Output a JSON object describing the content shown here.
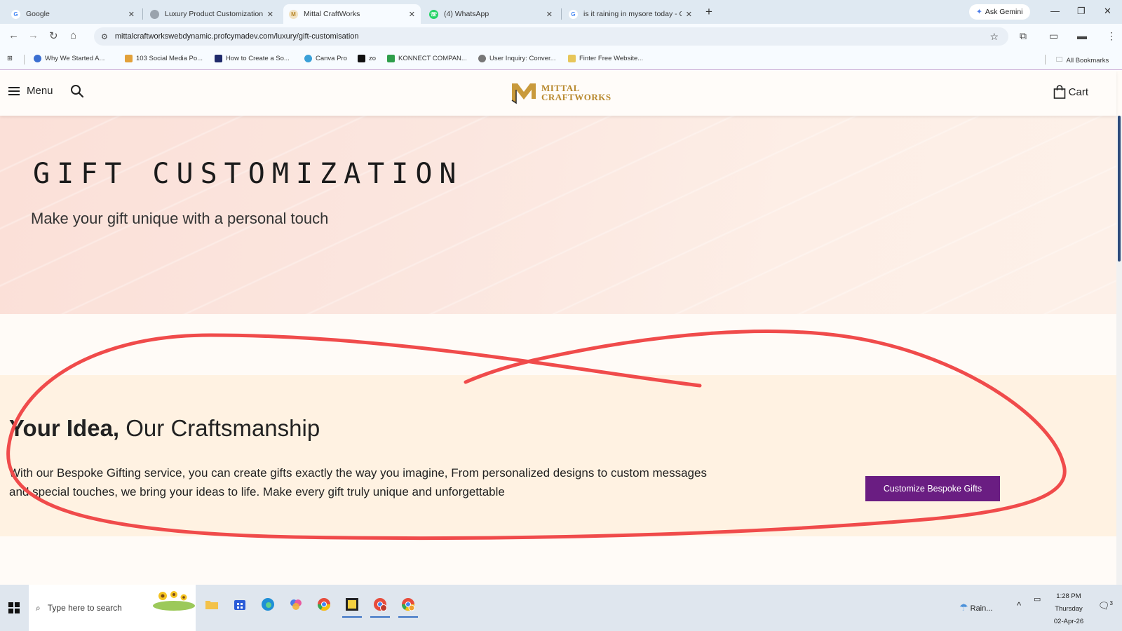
{
  "browser": {
    "tabs": [
      {
        "title": "Google",
        "favicon": "google-icon",
        "active": false
      },
      {
        "title": "Luxury Product Customization",
        "favicon": "globe-icon",
        "active": false
      },
      {
        "title": "Mittal CraftWorks",
        "favicon": "mittal-icon",
        "active": true
      },
      {
        "title": "(4) WhatsApp",
        "favicon": "whatsapp-icon",
        "active": false
      },
      {
        "title": "is it raining in mysore today - G",
        "favicon": "google-icon",
        "active": false
      }
    ],
    "ask_gemini": "Ask Gemini",
    "url": "mittalcraftworkswebdynamic.profcymadev.com/luxury/gift-customisation",
    "bookmarks": [
      "Why We Started A...",
      "103 Social Media Po...",
      "How to Create a So...",
      "Canva Pro",
      "zo",
      "KONNECT COMPAN...",
      "User Inquiry: Conver...",
      "Finter Free Website..."
    ],
    "all_bookmarks": "All Bookmarks"
  },
  "header": {
    "menu_label": "Menu",
    "logo_line1": "MITTAL",
    "logo_line2": "CRAFTWORKS",
    "cart_label": "Cart"
  },
  "hero": {
    "title": "GIFT CUSTOMIZATION",
    "subtitle": "Make your gift unique with a personal touch"
  },
  "idea_section": {
    "heading_bold": "Your Idea,",
    "heading_rest": " Our Craftsmanship",
    "description": "With our Bespoke Gifting service, you can create gifts exactly the way you imagine, From personalized designs to custom messages and special touches, we bring your ideas to life. Make every gift truly unique and unforgettable",
    "button_label": "Customize Bespoke Gifts"
  },
  "taskbar": {
    "search_placeholder": "Type here to search",
    "weather": "Rain...",
    "time": "1:28 PM",
    "day": "Thursday",
    "date": "02-Apr-26",
    "notification_count": "3"
  },
  "colors": {
    "brand_gold": "#b8892e",
    "button_purple": "#6a1d82",
    "annotation_red": "#f04b4b",
    "hero_peach": "#fbe0d8",
    "section_cream": "#fff2e2"
  }
}
